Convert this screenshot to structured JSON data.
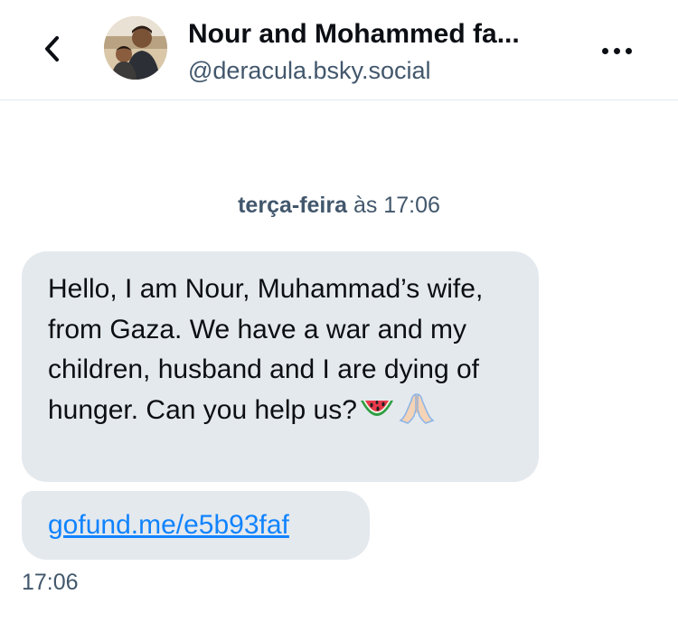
{
  "header": {
    "display_name": "Nour and Mohammed fa...",
    "handle": "@deracula.bsky.social",
    "back_icon": "chevron-left-icon",
    "more_icon": "more-horizontal-icon",
    "avatar_icon": "avatar-photo"
  },
  "conversation": {
    "date_day": "terça-feira",
    "date_rest": " às 17:06",
    "messages": [
      {
        "text": "Hello, I am Nour, Muhammad’s wife, from Gaza. We have a war and my children, husband and I are dying of hunger. Can you help us?",
        "emojis": [
          "watermelon-emoji",
          "folded-hands-emoji"
        ]
      },
      {
        "link": "gofund.me/e5b93faf"
      }
    ],
    "last_time": "17:06"
  },
  "colors": {
    "bubble": "#e4e9ee",
    "link": "#1083fe",
    "muted_text": "#42576c",
    "text": "#0b0f14"
  }
}
